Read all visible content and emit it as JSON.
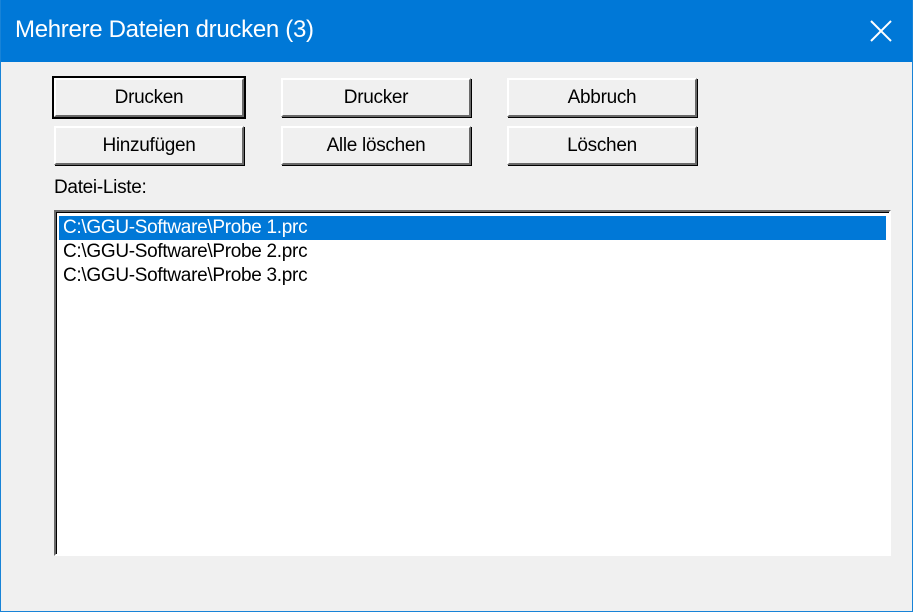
{
  "window": {
    "title": "Mehrere Dateien drucken (3)",
    "close_icon": "close-icon"
  },
  "buttons": {
    "print": "Drucken",
    "printer": "Drucker",
    "cancel": "Abbruch",
    "add": "Hinzufügen",
    "delete_all": "Alle löschen",
    "delete": "Löschen"
  },
  "file_list": {
    "label": "Datei-Liste:",
    "items": [
      {
        "path": "C:\\GGU-Software\\Probe 1.prc",
        "selected": true
      },
      {
        "path": "C:\\GGU-Software\\Probe 2.prc",
        "selected": false
      },
      {
        "path": "C:\\GGU-Software\\Probe 3.prc",
        "selected": false
      }
    ]
  },
  "colors": {
    "titlebar": "#0078d7",
    "selection": "#0078d7",
    "dialog_bg": "#f0f0f0"
  }
}
